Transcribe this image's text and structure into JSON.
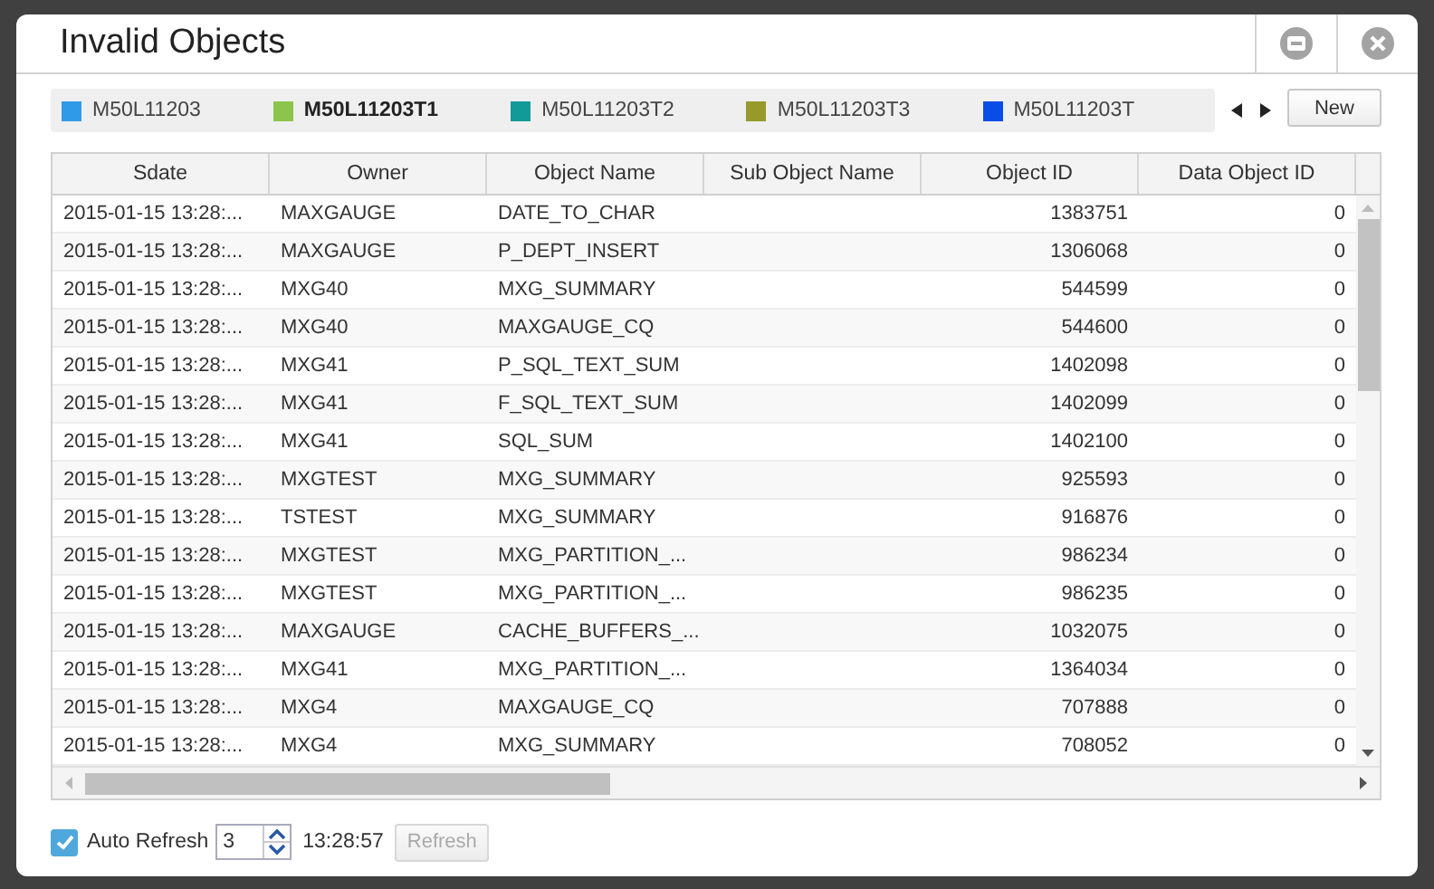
{
  "window": {
    "title": "Invalid Objects"
  },
  "tabs": [
    {
      "label": "M50L11203",
      "color": "#2f9be8",
      "selected": false
    },
    {
      "label": "M50L11203T1",
      "color": "#8cc54a",
      "selected": true
    },
    {
      "label": "M50L11203T2",
      "color": "#129a98",
      "selected": false
    },
    {
      "label": "M50L11203T3",
      "color": "#979a2b",
      "selected": false
    },
    {
      "label": "M50L11203T",
      "color": "#0a4de6",
      "selected": false
    }
  ],
  "new_button": "New",
  "table": {
    "columns": [
      "Sdate",
      "Owner",
      "Object Name",
      "Sub Object Name",
      "Object ID",
      "Data Object ID"
    ],
    "rows": [
      {
        "sdate": "2015-01-15 13:28:...",
        "owner": "MAXGAUGE",
        "object_name": "DATE_TO_CHAR",
        "object_id": "1383751",
        "data_object_id": "0"
      },
      {
        "sdate": "2015-01-15 13:28:...",
        "owner": "MAXGAUGE",
        "object_name": "P_DEPT_INSERT",
        "object_id": "1306068",
        "data_object_id": "0"
      },
      {
        "sdate": "2015-01-15 13:28:...",
        "owner": "MXG40",
        "object_name": "MXG_SUMMARY",
        "object_id": "544599",
        "data_object_id": "0"
      },
      {
        "sdate": "2015-01-15 13:28:...",
        "owner": "MXG40",
        "object_name": "MAXGAUGE_CQ",
        "object_id": "544600",
        "data_object_id": "0"
      },
      {
        "sdate": "2015-01-15 13:28:...",
        "owner": "MXG41",
        "object_name": "P_SQL_TEXT_SUM",
        "object_id": "1402098",
        "data_object_id": "0"
      },
      {
        "sdate": "2015-01-15 13:28:...",
        "owner": "MXG41",
        "object_name": "F_SQL_TEXT_SUM",
        "object_id": "1402099",
        "data_object_id": "0"
      },
      {
        "sdate": "2015-01-15 13:28:...",
        "owner": "MXG41",
        "object_name": "SQL_SUM",
        "object_id": "1402100",
        "data_object_id": "0"
      },
      {
        "sdate": "2015-01-15 13:28:...",
        "owner": "MXGTEST",
        "object_name": "MXG_SUMMARY",
        "object_id": "925593",
        "data_object_id": "0"
      },
      {
        "sdate": "2015-01-15 13:28:...",
        "owner": "TSTEST",
        "object_name": "MXG_SUMMARY",
        "object_id": "916876",
        "data_object_id": "0"
      },
      {
        "sdate": "2015-01-15 13:28:...",
        "owner": "MXGTEST",
        "object_name": "MXG_PARTITION_...",
        "object_id": "986234",
        "data_object_id": "0"
      },
      {
        "sdate": "2015-01-15 13:28:...",
        "owner": "MXGTEST",
        "object_name": "MXG_PARTITION_...",
        "object_id": "986235",
        "data_object_id": "0"
      },
      {
        "sdate": "2015-01-15 13:28:...",
        "owner": "MAXGAUGE",
        "object_name": "CACHE_BUFFERS_...",
        "object_id": "1032075",
        "data_object_id": "0"
      },
      {
        "sdate": "2015-01-15 13:28:...",
        "owner": "MXG41",
        "object_name": "MXG_PARTITION_...",
        "object_id": "1364034",
        "data_object_id": "0"
      },
      {
        "sdate": "2015-01-15 13:28:...",
        "owner": "MXG4",
        "object_name": "MAXGAUGE_CQ",
        "object_id": "707888",
        "data_object_id": "0"
      },
      {
        "sdate": "2015-01-15 13:28:...",
        "owner": "MXG4",
        "object_name": "MXG_SUMMARY",
        "object_id": "708052",
        "data_object_id": "0"
      }
    ]
  },
  "footer": {
    "auto_refresh": {
      "label": "Auto Refresh",
      "checked": true
    },
    "interval": "3",
    "time": "13:28:57",
    "refresh_button": {
      "label": "Refresh",
      "disabled": true
    }
  }
}
